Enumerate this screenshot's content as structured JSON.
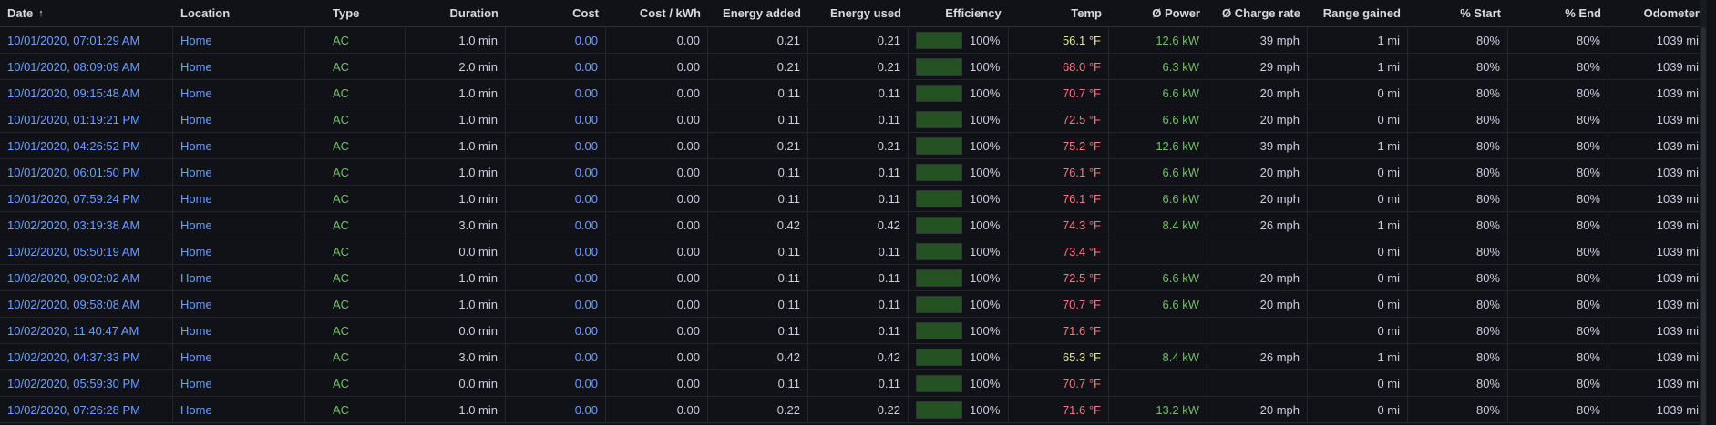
{
  "headers": {
    "date": "Date",
    "location": "Location",
    "type": "Type",
    "duration": "Duration",
    "cost": "Cost",
    "cost_kwh": "Cost / kWh",
    "energy_added": "Energy added",
    "energy_used": "Energy used",
    "efficiency": "Efficiency",
    "temp": "Temp",
    "power": "Ø Power",
    "charge_rate": "Ø Charge rate",
    "range_gained": "Range gained",
    "pct_start": "% Start",
    "pct_end": "% End",
    "odometer": "Odometer"
  },
  "sort_icon": "arrow-up-icon",
  "colors": {
    "background": "#111217",
    "link": "#6e9fff",
    "green": "#73bf69",
    "temp_cold": "#e6e6a0",
    "temp_warm": "#ff7383"
  },
  "rows": [
    {
      "date": "10/01/2020, 07:01:29 AM",
      "location": "Home",
      "type": "AC",
      "duration": "1.0 min",
      "cost": "0.00",
      "cost_kwh": "0.00",
      "energy_added": "0.21",
      "energy_used": "0.21",
      "efficiency": "100%",
      "efficiency_fraction": 1.0,
      "temp": "56.1 °F",
      "temp_class": "yellow",
      "power": "12.6 kW",
      "charge_rate": "39 mph",
      "range_gained": "1 mi",
      "pct_start": "80%",
      "pct_end": "80%",
      "odometer": "1039 mi"
    },
    {
      "date": "10/01/2020, 08:09:09 AM",
      "location": "Home",
      "type": "AC",
      "duration": "2.0 min",
      "cost": "0.00",
      "cost_kwh": "0.00",
      "energy_added": "0.21",
      "energy_used": "0.21",
      "efficiency": "100%",
      "efficiency_fraction": 1.0,
      "temp": "68.0 °F",
      "temp_class": "red",
      "power": "6.3 kW",
      "charge_rate": "29 mph",
      "range_gained": "1 mi",
      "pct_start": "80%",
      "pct_end": "80%",
      "odometer": "1039 mi"
    },
    {
      "date": "10/01/2020, 09:15:48 AM",
      "location": "Home",
      "type": "AC",
      "duration": "1.0 min",
      "cost": "0.00",
      "cost_kwh": "0.00",
      "energy_added": "0.11",
      "energy_used": "0.11",
      "efficiency": "100%",
      "efficiency_fraction": 1.0,
      "temp": "70.7 °F",
      "temp_class": "red",
      "power": "6.6 kW",
      "charge_rate": "20 mph",
      "range_gained": "0 mi",
      "pct_start": "80%",
      "pct_end": "80%",
      "odometer": "1039 mi"
    },
    {
      "date": "10/01/2020, 01:19:21 PM",
      "location": "Home",
      "type": "AC",
      "duration": "1.0 min",
      "cost": "0.00",
      "cost_kwh": "0.00",
      "energy_added": "0.11",
      "energy_used": "0.11",
      "efficiency": "100%",
      "efficiency_fraction": 1.0,
      "temp": "72.5 °F",
      "temp_class": "red",
      "power": "6.6 kW",
      "charge_rate": "20 mph",
      "range_gained": "0 mi",
      "pct_start": "80%",
      "pct_end": "80%",
      "odometer": "1039 mi"
    },
    {
      "date": "10/01/2020, 04:26:52 PM",
      "location": "Home",
      "type": "AC",
      "duration": "1.0 min",
      "cost": "0.00",
      "cost_kwh": "0.00",
      "energy_added": "0.21",
      "energy_used": "0.21",
      "efficiency": "100%",
      "efficiency_fraction": 1.0,
      "temp": "75.2 °F",
      "temp_class": "red",
      "power": "12.6 kW",
      "charge_rate": "39 mph",
      "range_gained": "1 mi",
      "pct_start": "80%",
      "pct_end": "80%",
      "odometer": "1039 mi"
    },
    {
      "date": "10/01/2020, 06:01:50 PM",
      "location": "Home",
      "type": "AC",
      "duration": "1.0 min",
      "cost": "0.00",
      "cost_kwh": "0.00",
      "energy_added": "0.11",
      "energy_used": "0.11",
      "efficiency": "100%",
      "efficiency_fraction": 1.0,
      "temp": "76.1 °F",
      "temp_class": "red",
      "power": "6.6 kW",
      "charge_rate": "20 mph",
      "range_gained": "0 mi",
      "pct_start": "80%",
      "pct_end": "80%",
      "odometer": "1039 mi"
    },
    {
      "date": "10/01/2020, 07:59:24 PM",
      "location": "Home",
      "type": "AC",
      "duration": "1.0 min",
      "cost": "0.00",
      "cost_kwh": "0.00",
      "energy_added": "0.11",
      "energy_used": "0.11",
      "efficiency": "100%",
      "efficiency_fraction": 1.0,
      "temp": "76.1 °F",
      "temp_class": "red",
      "power": "6.6 kW",
      "charge_rate": "20 mph",
      "range_gained": "0 mi",
      "pct_start": "80%",
      "pct_end": "80%",
      "odometer": "1039 mi"
    },
    {
      "date": "10/02/2020, 03:19:38 AM",
      "location": "Home",
      "type": "AC",
      "duration": "3.0 min",
      "cost": "0.00",
      "cost_kwh": "0.00",
      "energy_added": "0.42",
      "energy_used": "0.42",
      "efficiency": "100%",
      "efficiency_fraction": 1.0,
      "temp": "74.3 °F",
      "temp_class": "red",
      "power": "8.4 kW",
      "charge_rate": "26 mph",
      "range_gained": "1 mi",
      "pct_start": "80%",
      "pct_end": "80%",
      "odometer": "1039 mi"
    },
    {
      "date": "10/02/2020, 05:50:19 AM",
      "location": "Home",
      "type": "AC",
      "duration": "0.0 min",
      "cost": "0.00",
      "cost_kwh": "0.00",
      "energy_added": "0.11",
      "energy_used": "0.11",
      "efficiency": "100%",
      "efficiency_fraction": 1.0,
      "temp": "73.4 °F",
      "temp_class": "red",
      "power": "",
      "charge_rate": "",
      "range_gained": "0 mi",
      "pct_start": "80%",
      "pct_end": "80%",
      "odometer": "1039 mi"
    },
    {
      "date": "10/02/2020, 09:02:02 AM",
      "location": "Home",
      "type": "AC",
      "duration": "1.0 min",
      "cost": "0.00",
      "cost_kwh": "0.00",
      "energy_added": "0.11",
      "energy_used": "0.11",
      "efficiency": "100%",
      "efficiency_fraction": 1.0,
      "temp": "72.5 °F",
      "temp_class": "red",
      "power": "6.6 kW",
      "charge_rate": "20 mph",
      "range_gained": "0 mi",
      "pct_start": "80%",
      "pct_end": "80%",
      "odometer": "1039 mi"
    },
    {
      "date": "10/02/2020, 09:58:08 AM",
      "location": "Home",
      "type": "AC",
      "duration": "1.0 min",
      "cost": "0.00",
      "cost_kwh": "0.00",
      "energy_added": "0.11",
      "energy_used": "0.11",
      "efficiency": "100%",
      "efficiency_fraction": 1.0,
      "temp": "70.7 °F",
      "temp_class": "red",
      "power": "6.6 kW",
      "charge_rate": "20 mph",
      "range_gained": "0 mi",
      "pct_start": "80%",
      "pct_end": "80%",
      "odometer": "1039 mi"
    },
    {
      "date": "10/02/2020, 11:40:47 AM",
      "location": "Home",
      "type": "AC",
      "duration": "0.0 min",
      "cost": "0.00",
      "cost_kwh": "0.00",
      "energy_added": "0.11",
      "energy_used": "0.11",
      "efficiency": "100%",
      "efficiency_fraction": 1.0,
      "temp": "71.6 °F",
      "temp_class": "red",
      "power": "",
      "charge_rate": "",
      "range_gained": "0 mi",
      "pct_start": "80%",
      "pct_end": "80%",
      "odometer": "1039 mi"
    },
    {
      "date": "10/02/2020, 04:37:33 PM",
      "location": "Home",
      "type": "AC",
      "duration": "3.0 min",
      "cost": "0.00",
      "cost_kwh": "0.00",
      "energy_added": "0.42",
      "energy_used": "0.42",
      "efficiency": "100%",
      "efficiency_fraction": 1.0,
      "temp": "65.3 °F",
      "temp_class": "yellow",
      "power": "8.4 kW",
      "charge_rate": "26 mph",
      "range_gained": "1 mi",
      "pct_start": "80%",
      "pct_end": "80%",
      "odometer": "1039 mi"
    },
    {
      "date": "10/02/2020, 05:59:30 PM",
      "location": "Home",
      "type": "AC",
      "duration": "0.0 min",
      "cost": "0.00",
      "cost_kwh": "0.00",
      "energy_added": "0.11",
      "energy_used": "0.11",
      "efficiency": "100%",
      "efficiency_fraction": 1.0,
      "temp": "70.7 °F",
      "temp_class": "red",
      "power": "",
      "charge_rate": "",
      "range_gained": "0 mi",
      "pct_start": "80%",
      "pct_end": "80%",
      "odometer": "1039 mi"
    },
    {
      "date": "10/02/2020, 07:26:28 PM",
      "location": "Home",
      "type": "AC",
      "duration": "1.0 min",
      "cost": "0.00",
      "cost_kwh": "0.00",
      "energy_added": "0.22",
      "energy_used": "0.22",
      "efficiency": "100%",
      "efficiency_fraction": 1.0,
      "temp": "71.6 °F",
      "temp_class": "red",
      "power": "13.2 kW",
      "charge_rate": "20 mph",
      "range_gained": "0 mi",
      "pct_start": "80%",
      "pct_end": "80%",
      "odometer": "1039 mi"
    }
  ]
}
